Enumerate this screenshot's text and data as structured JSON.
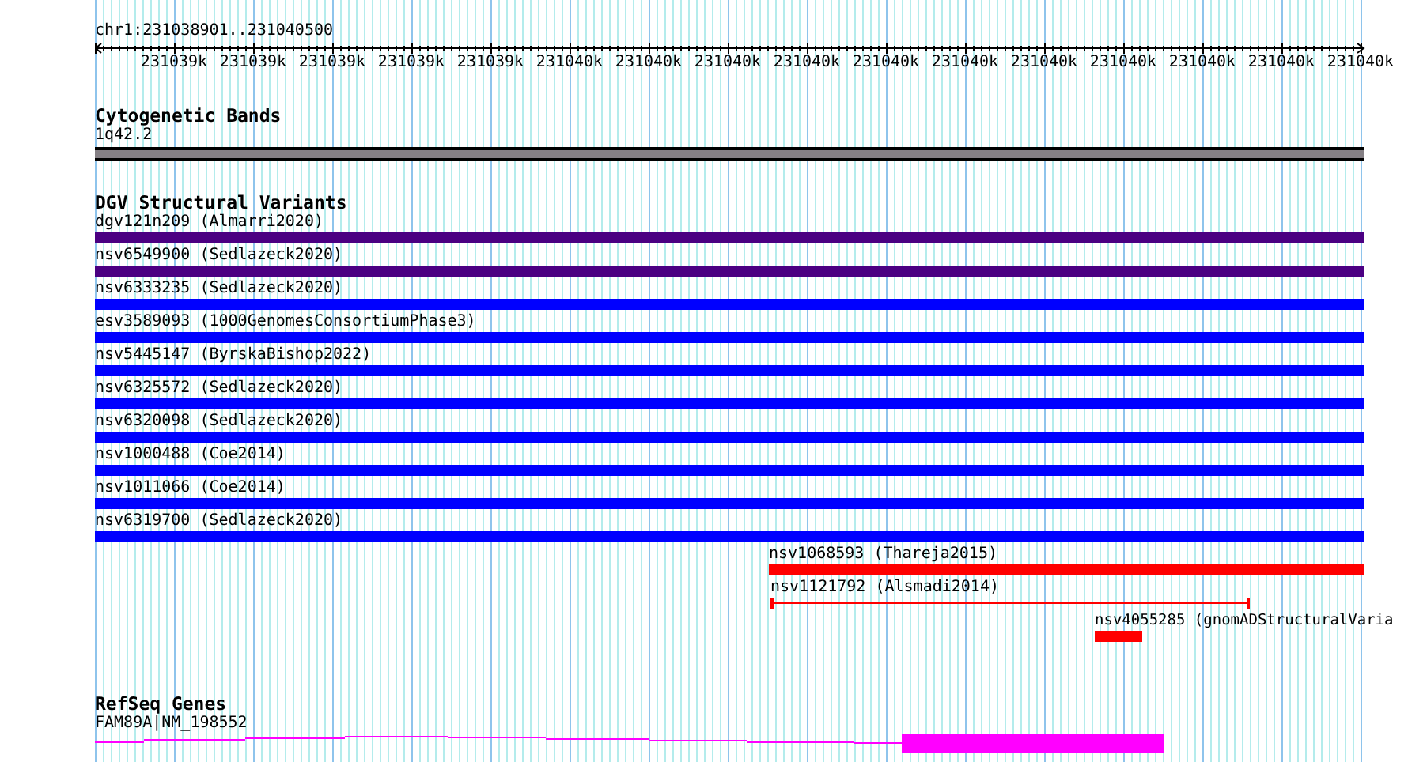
{
  "ruler": {
    "range": "chr1:231038901..231040500",
    "labels": [
      "231039k",
      "231039k",
      "231039k",
      "231039k",
      "231039k",
      "231040k",
      "231040k",
      "231040k",
      "231040k",
      "231040k",
      "231040k",
      "231040k",
      "231040k",
      "231040k",
      "231040k",
      "231040k"
    ]
  },
  "tracks": [
    {
      "title": "Cytogenetic Bands",
      "features": [
        {
          "label": "1q42.2",
          "kind": "band"
        }
      ]
    },
    {
      "title": "DGV Structural Variants",
      "features": [
        {
          "label": "dgv121n209 (Almarri2020)",
          "kind": "bar",
          "color": "#4b0082"
        },
        {
          "label": "nsv6549900 (Sedlazeck2020)",
          "kind": "bar",
          "color": "#4b0082"
        },
        {
          "label": "nsv6333235 (Sedlazeck2020)",
          "kind": "bar",
          "color": "#0000ff"
        },
        {
          "label": "esv3589093 (1000GenomesConsortiumPhase3)",
          "kind": "bar",
          "color": "#0000ff"
        },
        {
          "label": "nsv5445147 (ByrskaBishop2022)",
          "kind": "bar",
          "color": "#0000ff"
        },
        {
          "label": "nsv6325572 (Sedlazeck2020)",
          "kind": "bar",
          "color": "#0000ff"
        },
        {
          "label": "nsv6320098 (Sedlazeck2020)",
          "kind": "bar",
          "color": "#0000ff"
        },
        {
          "label": "nsv1000488 (Coe2014)",
          "kind": "bar",
          "color": "#0000ff"
        },
        {
          "label": "nsv1011066 (Coe2014)",
          "kind": "bar",
          "color": "#0000ff"
        },
        {
          "label": "nsv6319700 (Sedlazeck2020)",
          "kind": "bar",
          "color": "#0000ff"
        },
        {
          "label": "nsv1068593 (Thareja2015)",
          "kind": "bar",
          "color": "#ff0000"
        },
        {
          "label": "nsv1121792 (Alsmadi2014)",
          "kind": "span",
          "color": "#ff0000"
        },
        {
          "label": "nsv4055285 (gnomADStructuralVaria",
          "kind": "bar",
          "color": "#ff0000"
        }
      ]
    },
    {
      "title": "RefSeq Genes",
      "features": [
        {
          "label": "FAM89A|NM_198552",
          "kind": "gene"
        }
      ]
    }
  ]
}
